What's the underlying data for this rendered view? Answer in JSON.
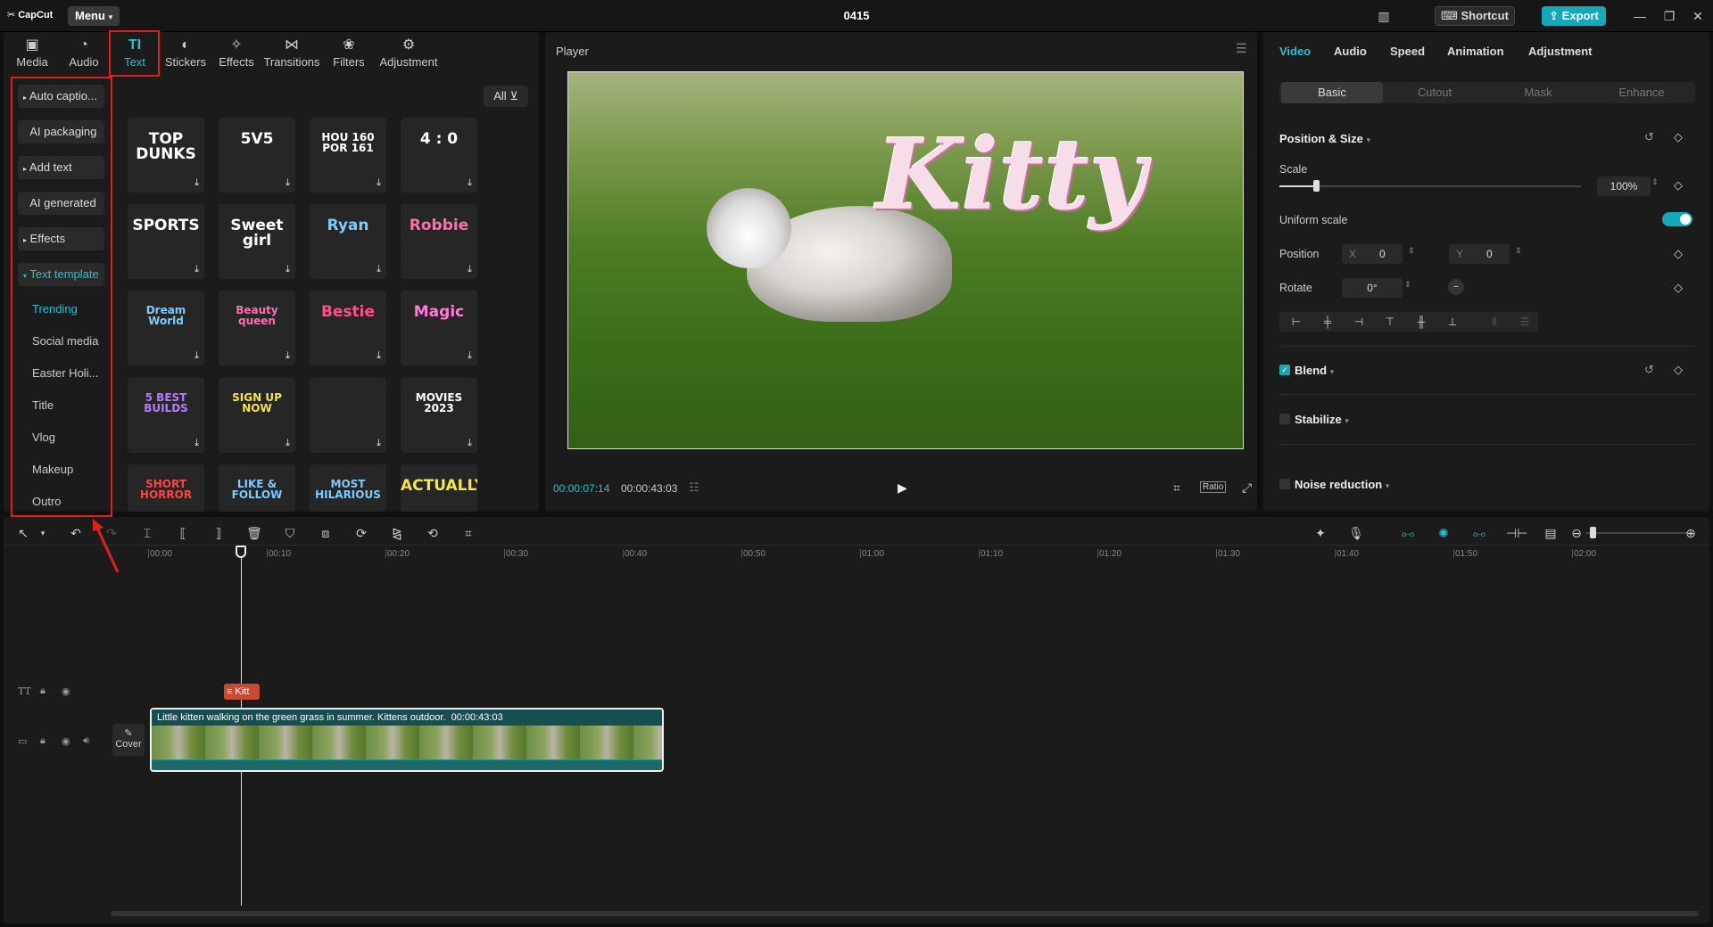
{
  "app": {
    "logo_text": "CapCut",
    "menu_label": "Menu",
    "project_name": "0415",
    "shortcut_label": "Shortcut",
    "export_label": "Export"
  },
  "top_tabs": [
    {
      "label": "Media",
      "icon": "media-icon"
    },
    {
      "label": "Audio",
      "icon": "audio-icon"
    },
    {
      "label": "Text",
      "icon": "text-icon"
    },
    {
      "label": "Stickers",
      "icon": "stickers-icon"
    },
    {
      "label": "Effects",
      "icon": "effects-icon"
    },
    {
      "label": "Transitions",
      "icon": "transitions-icon"
    },
    {
      "label": "Filters",
      "icon": "filters-icon"
    },
    {
      "label": "Adjustment",
      "icon": "adjustment-icon"
    }
  ],
  "sidebar": {
    "buttons": [
      "Auto captio...",
      "AI packaging",
      "Add text",
      "AI generated",
      "Effects",
      "Text template"
    ],
    "subitems": [
      "Trending",
      "Social media",
      "Easter Holi...",
      "Title",
      "Vlog",
      "Makeup",
      "Outro"
    ]
  },
  "filter_label": "All",
  "templates": [
    {
      "text": "TOP DUNKS",
      "color": "#ffffff"
    },
    {
      "text": "5V5",
      "color": "#ffffff"
    },
    {
      "text": "HOU 160 POR 161",
      "color": "#ffffff"
    },
    {
      "text": "4 : 0",
      "color": "#ffffff"
    },
    {
      "text": "SPORTS",
      "color": "#ffffff"
    },
    {
      "text": "Sweet girl",
      "color": "#ffffff"
    },
    {
      "text": "Ryan",
      "color": "#7ecbff"
    },
    {
      "text": "Robbie",
      "color": "#ff6fb0"
    },
    {
      "text": "Dream World",
      "color": "#7ecbff"
    },
    {
      "text": "Beauty queen",
      "color": "#ff6fb0"
    },
    {
      "text": "Bestie",
      "color": "#ff4f8b"
    },
    {
      "text": "Magic",
      "color": "#ff7ad9"
    },
    {
      "text": "5 BEST BUILDS",
      "color": "#b57cff"
    },
    {
      "text": "SIGN UP NOW",
      "color": "#f5e44a"
    },
    {
      "text": "",
      "color": "#ffffff"
    },
    {
      "text": "MOVIES 2023",
      "color": "#ffffff"
    },
    {
      "text": "SHORT HORROR",
      "color": "#ff4444"
    },
    {
      "text": "LIKE & FOLLOW",
      "color": "#7ecbff"
    },
    {
      "text": "MOST HILARIOUS",
      "color": "#7ecbff"
    },
    {
      "text": "ACTUALLY",
      "color": "#f5e44a"
    }
  ],
  "player": {
    "title": "Player",
    "overlay_text": "Kitty",
    "current_time": "00:00:07:14",
    "total_time": "00:00:43:03",
    "ratio_label": "Ratio"
  },
  "right_panel": {
    "tabs": [
      "Video",
      "Audio",
      "Speed",
      "Animation",
      "Adjustment"
    ],
    "segments": [
      "Basic",
      "Cutout",
      "Mask",
      "Enhance"
    ],
    "position_size_title": "Position & Size",
    "scale_label": "Scale",
    "scale_value": "100%",
    "scale_fraction": 0.12,
    "uniform_scale_label": "Uniform scale",
    "position_label": "Position",
    "x_label": "X",
    "x_value": "0",
    "y_label": "Y",
    "y_value": "0",
    "rotate_label": "Rotate",
    "rotate_value": "0°",
    "blend_label": "Blend",
    "stabilize_label": "Stabilize",
    "noise_label": "Noise reduction"
  },
  "timeline": {
    "ticks": [
      "00:00",
      "00:10",
      "00:20",
      "00:30",
      "00:40",
      "00:50",
      "01:00",
      "01:10",
      "01:20",
      "01:30",
      "01:40",
      "01:50",
      "02:00"
    ],
    "text_clip_label": "Kitt",
    "video_clip_title": "Little kitten walking on the green grass in summer. Kittens outdoor.",
    "video_clip_duration": "00:00:43:03",
    "cover_label": "Cover"
  }
}
